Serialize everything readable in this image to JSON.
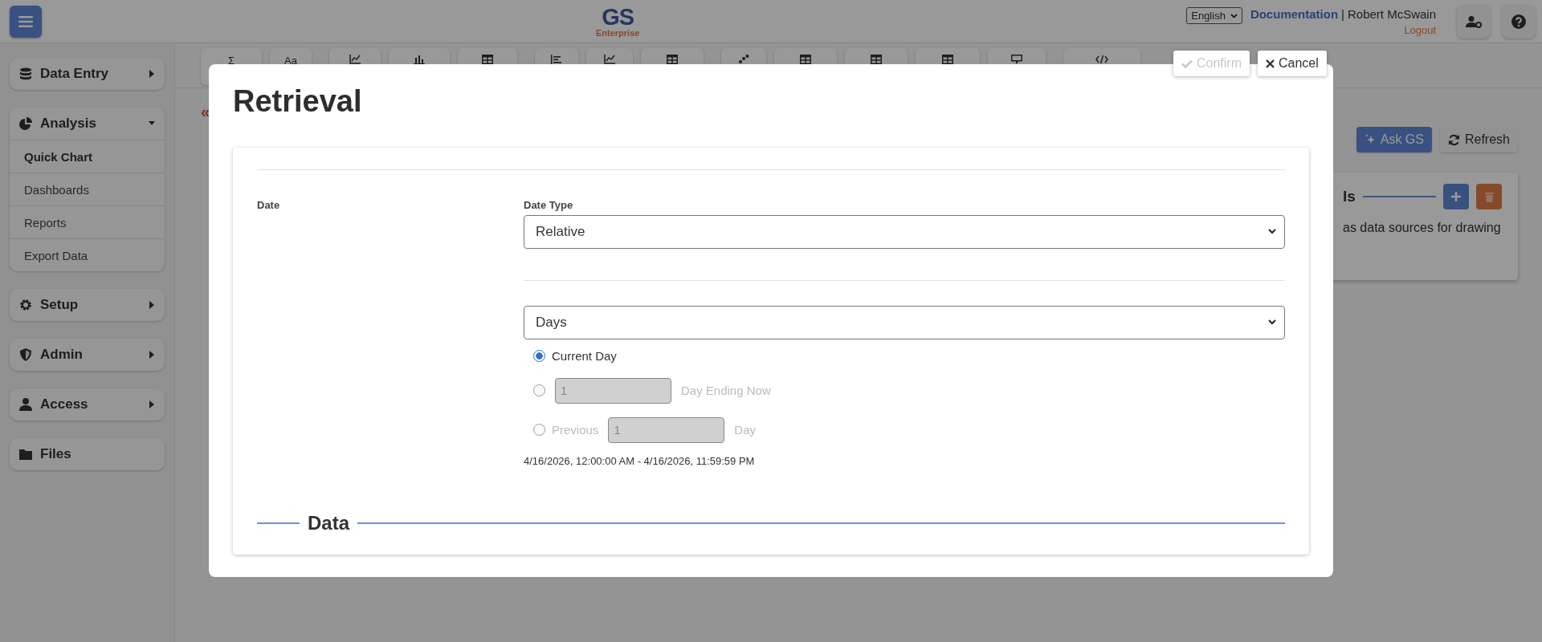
{
  "header": {
    "logo": {
      "title": "GS",
      "subtitle": "Enterprise"
    },
    "language": "English",
    "documentation_link": "Documentation",
    "separator": "|",
    "user_name": "Robert McSwain",
    "logout_link": "Logout"
  },
  "sidebar": {
    "groups": [
      {
        "label": "Data Entry",
        "expanded": false
      },
      {
        "label": "Analysis",
        "expanded": true,
        "children": [
          {
            "label": "Quick Chart",
            "selected": true
          },
          {
            "label": "Dashboards",
            "selected": false
          },
          {
            "label": "Reports",
            "selected": false
          },
          {
            "label": "Export Data",
            "selected": false
          }
        ]
      },
      {
        "label": "Setup",
        "expanded": false
      },
      {
        "label": "Admin",
        "expanded": false
      },
      {
        "label": "Access",
        "expanded": false
      },
      {
        "label": "Files"
      }
    ]
  },
  "toolbar": {
    "buttons": [
      {
        "kind": "glyph",
        "text": "Σ"
      },
      {
        "kind": "glyph",
        "text": "Aa"
      },
      {
        "kind": "line-chart"
      },
      {
        "kind": "bar-chart"
      },
      {
        "kind": "table"
      },
      {
        "kind": "bars"
      },
      {
        "kind": "line-chart"
      },
      {
        "kind": "table"
      },
      {
        "kind": "scatter"
      },
      {
        "kind": "table"
      },
      {
        "kind": "table"
      },
      {
        "kind": "table"
      },
      {
        "kind": "monitor"
      },
      {
        "kind": "code"
      }
    ]
  },
  "page": {
    "back_link": "«",
    "buttons": [
      {
        "label": "Ask GS",
        "kind": "primary"
      },
      {
        "label": "Refresh",
        "kind": "default"
      }
    ],
    "panel": {
      "title_fragment": "ls",
      "text_fragment": "as data sources for drawing"
    }
  },
  "modal": {
    "title": "Retrieval",
    "confirm": {
      "label": "Confirm",
      "disabled": true
    },
    "cancel": {
      "label": "Cancel"
    },
    "date_label": "Date",
    "date_type": {
      "label": "Date Type",
      "value": "Relative"
    },
    "period": {
      "value": "Days"
    },
    "options": [
      {
        "kind": "plain",
        "label": "Current Day",
        "selected": true,
        "disabled": false
      },
      {
        "kind": "count",
        "value": "1",
        "suffix": "Day Ending Now",
        "selected": false,
        "disabled": true
      },
      {
        "kind": "previous",
        "prefix": "Previous",
        "value": "1",
        "suffix": "Day",
        "selected": false,
        "disabled": true
      }
    ],
    "range_text": "4/16/2026, 12:00:00 AM - 4/16/2026, 11:59:59 PM",
    "section_title": "Data"
  }
}
